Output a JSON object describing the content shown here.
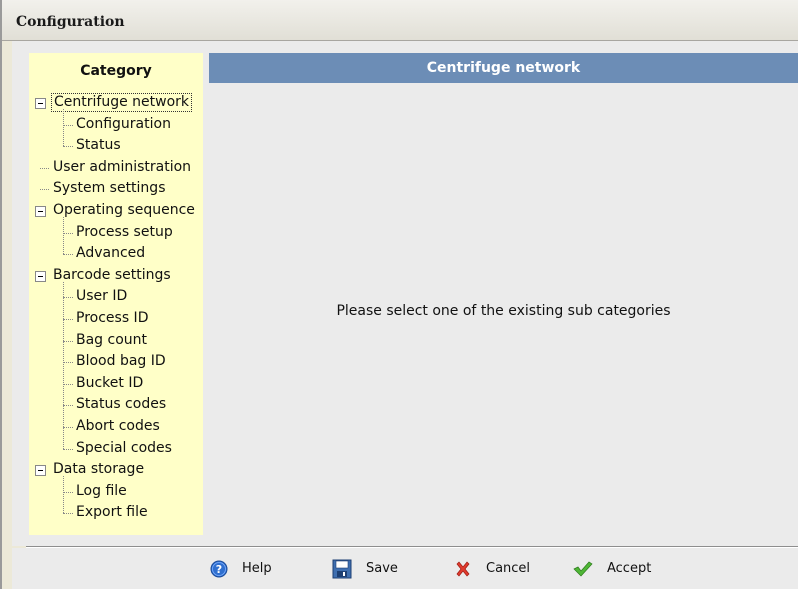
{
  "window": {
    "title": "Configuration"
  },
  "category": {
    "heading": "Category",
    "items": [
      {
        "label": "Centrifuge network",
        "level": 0,
        "expandable": true,
        "selected": true
      },
      {
        "label": "Configuration",
        "level": 1
      },
      {
        "label": "Status",
        "level": 1
      },
      {
        "label": "User administration",
        "level": 0
      },
      {
        "label": "System settings",
        "level": 0
      },
      {
        "label": "Operating sequence",
        "level": 0,
        "expandable": true
      },
      {
        "label": "Process setup",
        "level": 1
      },
      {
        "label": "Advanced",
        "level": 1
      },
      {
        "label": "Barcode settings",
        "level": 0,
        "expandable": true
      },
      {
        "label": "User ID",
        "level": 1
      },
      {
        "label": "Process ID",
        "level": 1
      },
      {
        "label": "Bag count",
        "level": 1
      },
      {
        "label": "Blood bag ID",
        "level": 1
      },
      {
        "label": "Bucket ID",
        "level": 1
      },
      {
        "label": "Status codes",
        "level": 1
      },
      {
        "label": "Abort codes",
        "level": 1
      },
      {
        "label": "Special codes",
        "level": 1
      },
      {
        "label": "Data storage",
        "level": 0,
        "expandable": true
      },
      {
        "label": "Log file",
        "level": 1
      },
      {
        "label": "Export file",
        "level": 1
      }
    ]
  },
  "main": {
    "header": "Centrifuge network",
    "message": "Please select one of the existing sub categories"
  },
  "buttons": {
    "help": {
      "label": "Help",
      "icon": "help-icon"
    },
    "save": {
      "label": "Save",
      "icon": "floppy-disk-icon"
    },
    "cancel": {
      "label": "Cancel",
      "icon": "red-x-icon"
    },
    "accept": {
      "label": "Accept",
      "icon": "green-check-icon"
    }
  },
  "colors": {
    "category_bg": "#ffffc8",
    "header_bg": "#6c8db6",
    "content_bg": "#ebebeb"
  }
}
